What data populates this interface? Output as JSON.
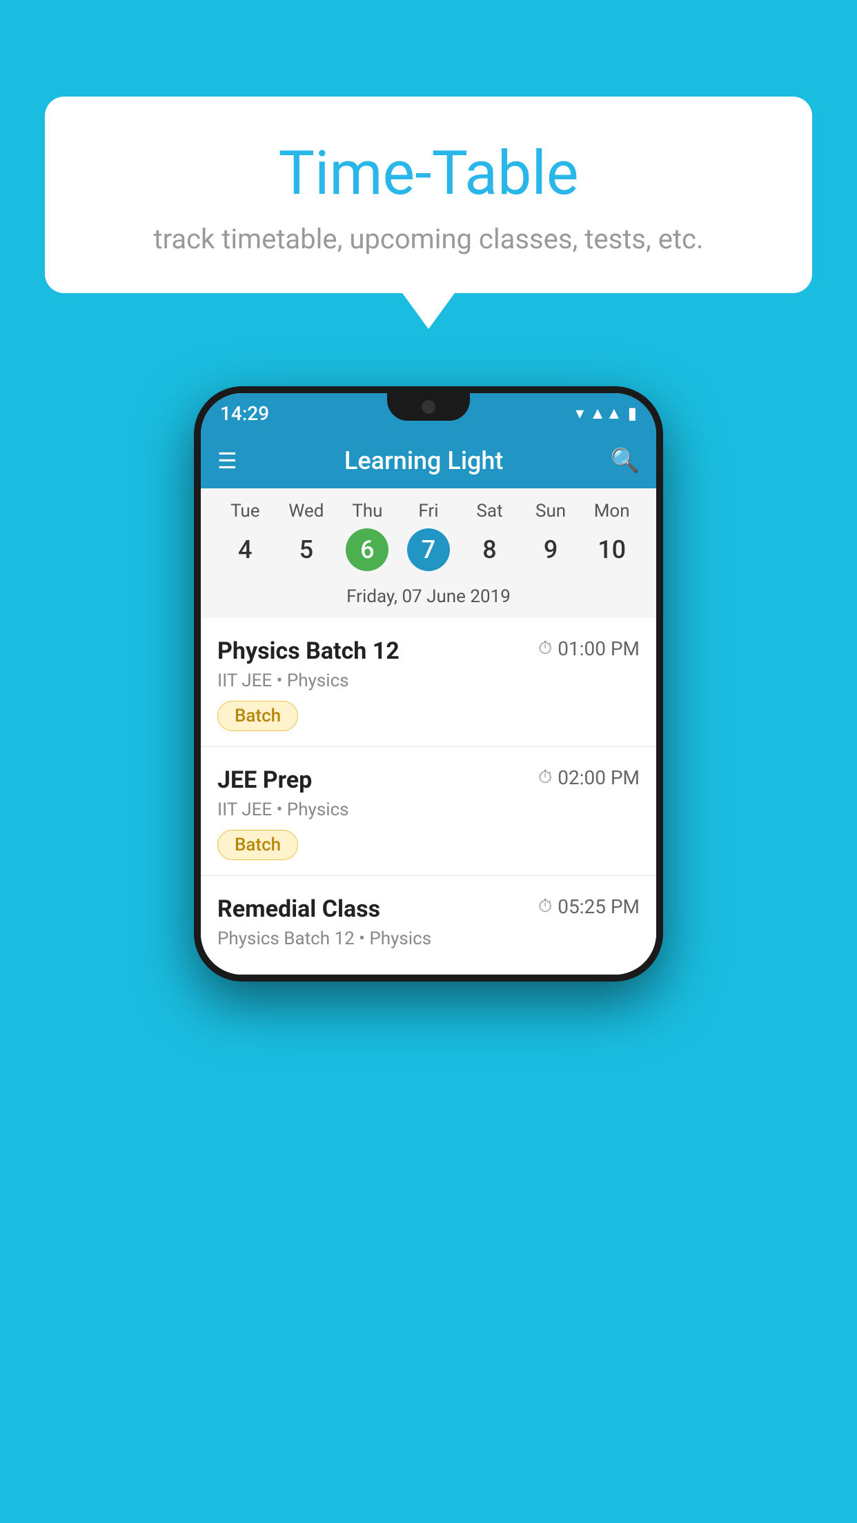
{
  "background_color": "#1ABDE0",
  "bubble": {
    "title": "Time-Table",
    "subtitle": "track timetable, upcoming classes, tests, etc."
  },
  "phone": {
    "status_bar": {
      "time": "14:29"
    },
    "app_bar": {
      "title": "Learning Light"
    },
    "calendar": {
      "days": [
        {
          "label": "Tue",
          "num": "4",
          "state": "normal"
        },
        {
          "label": "Wed",
          "num": "5",
          "state": "normal"
        },
        {
          "label": "Thu",
          "num": "6",
          "state": "today"
        },
        {
          "label": "Fri",
          "num": "7",
          "state": "selected"
        },
        {
          "label": "Sat",
          "num": "8",
          "state": "normal"
        },
        {
          "label": "Sun",
          "num": "9",
          "state": "normal"
        },
        {
          "label": "Mon",
          "num": "10",
          "state": "normal"
        }
      ],
      "selected_date_label": "Friday, 07 June 2019"
    },
    "schedule": [
      {
        "title": "Physics Batch 12",
        "time": "01:00 PM",
        "subtitle": "IIT JEE • Physics",
        "tag": "Batch"
      },
      {
        "title": "JEE Prep",
        "time": "02:00 PM",
        "subtitle": "IIT JEE • Physics",
        "tag": "Batch"
      },
      {
        "title": "Remedial Class",
        "time": "05:25 PM",
        "subtitle": "Physics Batch 12 • Physics",
        "tag": null
      }
    ]
  }
}
